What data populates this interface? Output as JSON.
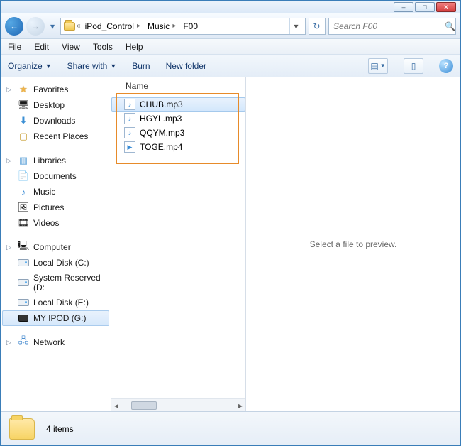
{
  "window_controls": {
    "minimize": "–",
    "maximize": "□",
    "close": "✕"
  },
  "breadcrumb": {
    "prefix": "«",
    "segments": [
      "iPod_Control",
      "Music",
      "F00"
    ]
  },
  "nav": {
    "back_glyph": "←",
    "fwd_glyph": "→",
    "dropdown_glyph": "▾",
    "refresh_glyph": "↻"
  },
  "search": {
    "placeholder": "Search F00",
    "icon": "🔍"
  },
  "menubar": {
    "file": "File",
    "edit": "Edit",
    "view": "View",
    "tools": "Tools",
    "help": "Help"
  },
  "toolbar": {
    "organize": "Organize",
    "share": "Share with",
    "burn": "Burn",
    "newfolder": "New folder",
    "view_glyph": "▤",
    "preview_glyph": "▯",
    "help_glyph": "?"
  },
  "sidebar": {
    "favorites": {
      "label": "Favorites",
      "items": [
        "Desktop",
        "Downloads",
        "Recent Places"
      ]
    },
    "libraries": {
      "label": "Libraries",
      "items": [
        "Documents",
        "Music",
        "Pictures",
        "Videos"
      ]
    },
    "computer": {
      "label": "Computer",
      "items": [
        "Local Disk (C:)",
        "System Reserved (D:",
        "Local Disk (E:)",
        "MY IPOD (G:)"
      ],
      "selected_index": 3
    },
    "network": {
      "label": "Network"
    }
  },
  "filepane": {
    "column_header": "Name",
    "files": [
      "CHUB.mp3",
      "HGYL.mp3",
      "QQYM.mp3",
      "TOGE.mp4"
    ],
    "selected_index": 0
  },
  "preview": {
    "empty_text": "Select a file to preview."
  },
  "statusbar": {
    "count_text": "4 items"
  }
}
